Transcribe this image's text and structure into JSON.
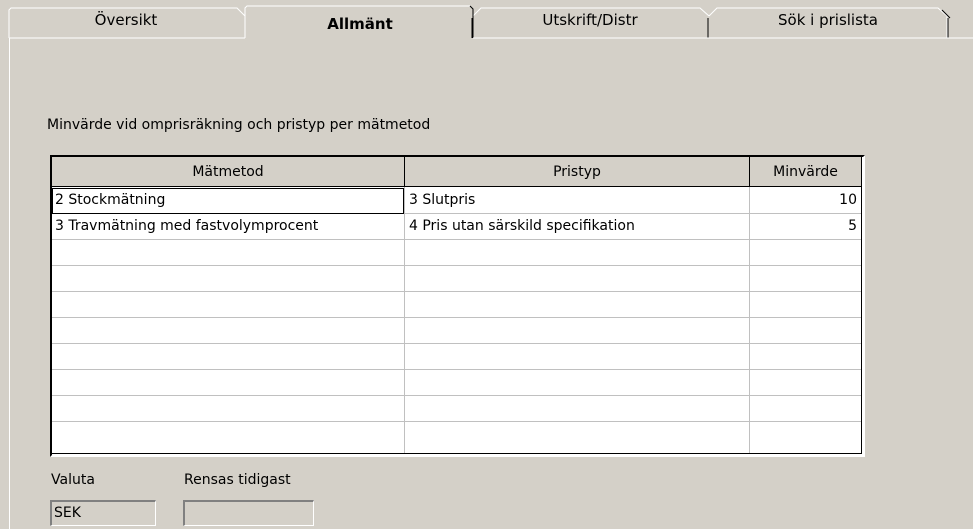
{
  "tabs": [
    {
      "label": "Översikt",
      "active": false
    },
    {
      "label": "Allmänt",
      "active": true
    },
    {
      "label": "Utskrift/Distr",
      "active": false
    },
    {
      "label": "Sök i prislista",
      "active": false
    }
  ],
  "section_heading": "Minvärde vid omprisräkning och pristyp per mätmetod",
  "grid": {
    "columns": [
      "Mätmetod",
      "Pristyp",
      "Minvärde"
    ],
    "rows": [
      {
        "matmetod": "2 Stockmätning",
        "pristyp": "3 Slutpris",
        "minvarde": "10"
      },
      {
        "matmetod": "3 Travmätning med fastvolymprocent",
        "pristyp": "4 Pris utan särskild specifikation",
        "minvarde": "5"
      }
    ]
  },
  "valuta": {
    "label": "Valuta",
    "value": "SEK"
  },
  "rensas": {
    "label": "Rensas tidigast",
    "value": ""
  }
}
